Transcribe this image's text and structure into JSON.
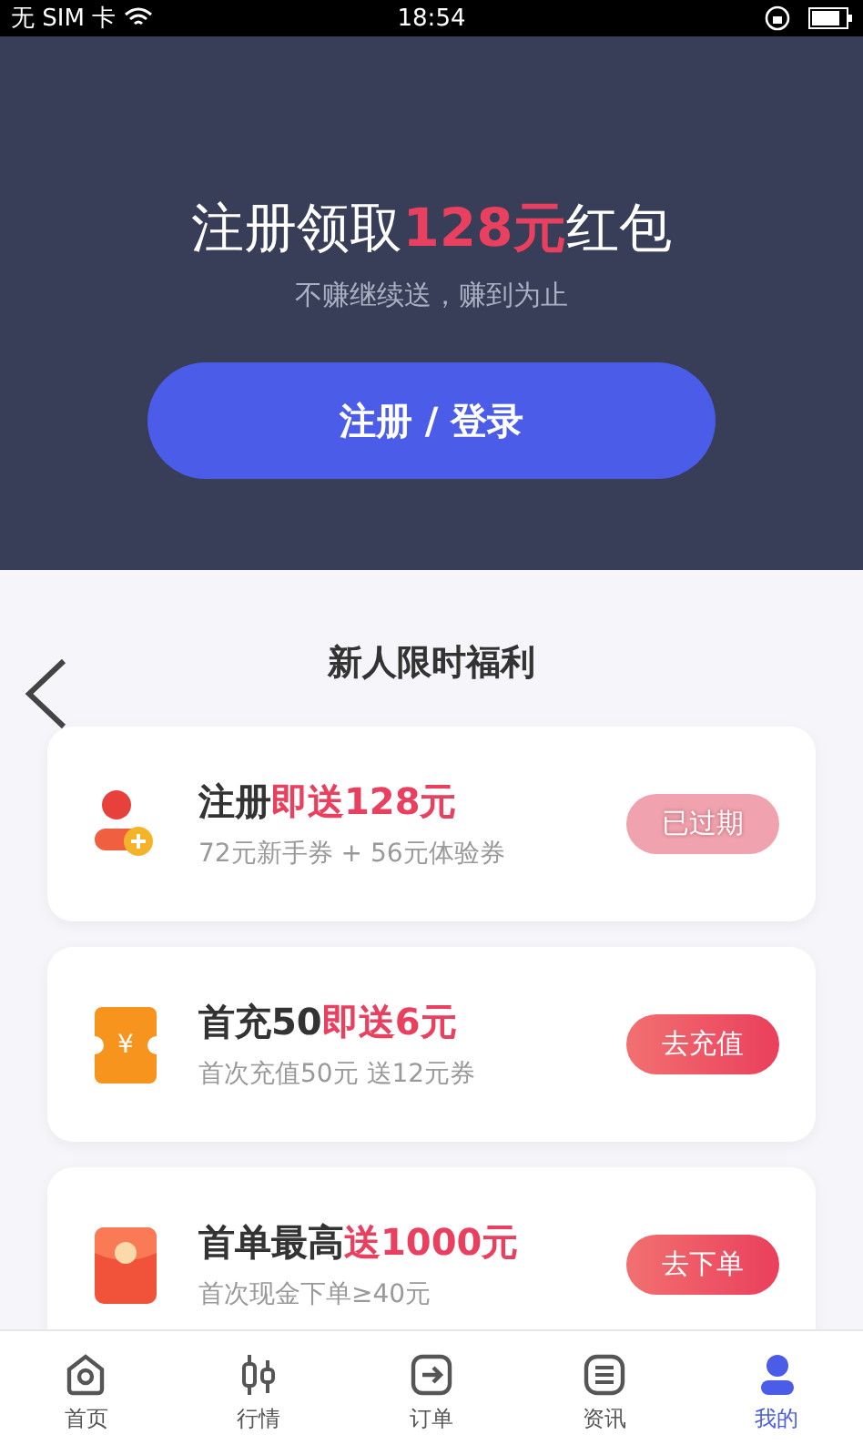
{
  "status_bar": {
    "carrier": "无 SIM 卡",
    "time": "18:54"
  },
  "hero": {
    "title_before": "注册领取",
    "title_highlight": "128元",
    "title_after": "红包",
    "subtitle": "不赚继续送，赚到为止",
    "button": "注册 / 登录"
  },
  "section": {
    "title": "新人限时福利"
  },
  "offers": [
    {
      "kind": "person",
      "title": "注册",
      "highlight": "即送128元",
      "lines": [
        "72元新手券 + 56元体验券"
      ],
      "button": "已过期",
      "expired": true
    },
    {
      "kind": "ticket",
      "icon_text": "¥",
      "title": "首充50",
      "highlight": "即送6元",
      "lines": [
        "首次充值50元 送12元券"
      ],
      "button": "去充值",
      "expired": false
    },
    {
      "kind": "envelope",
      "title": "首单最高",
      "highlight": "送1000元",
      "lines": [
        "首次现金下单≥40元"
      ],
      "button": "去下单",
      "expired": false
    }
  ],
  "tabs": [
    {
      "kind": "home",
      "label": "首页",
      "selected": false
    },
    {
      "kind": "market",
      "label": "行情",
      "selected": false
    },
    {
      "kind": "order",
      "label": "订单",
      "selected": false
    },
    {
      "kind": "news",
      "label": "资讯",
      "selected": false
    },
    {
      "kind": "me",
      "label": "我的",
      "selected": true
    }
  ]
}
